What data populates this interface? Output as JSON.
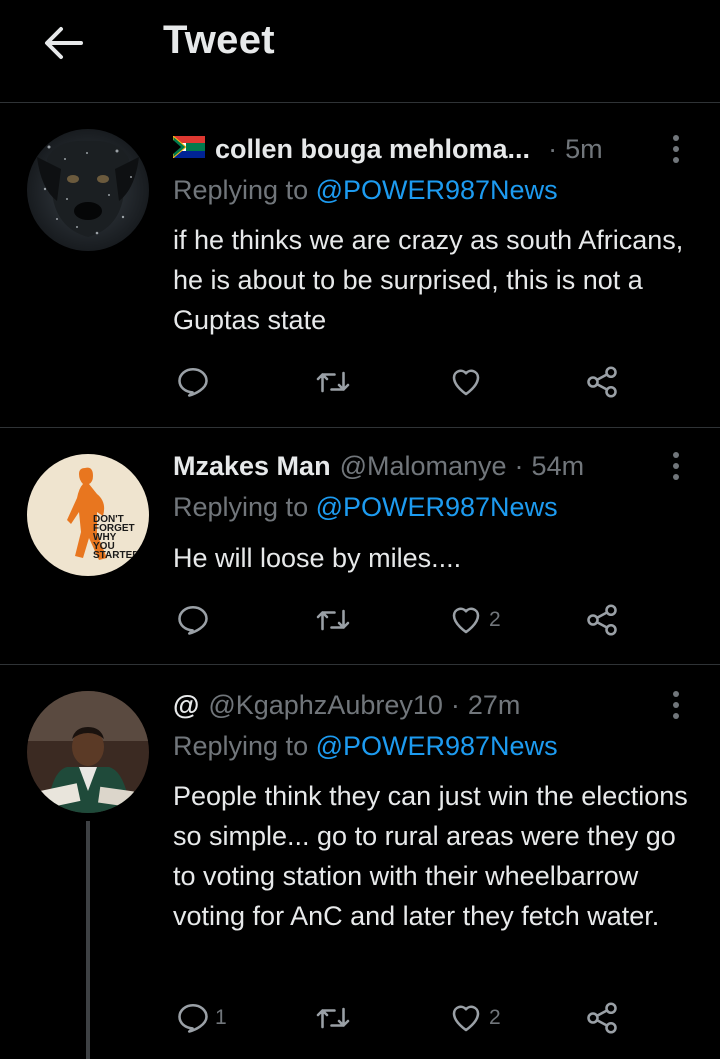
{
  "header": {
    "title": "Tweet",
    "back_icon": "arrow-left-icon"
  },
  "colors": {
    "background": "#000000",
    "link": "#1d9bf0",
    "muted": "#71767b",
    "text": "#e7e9ea",
    "divider": "#2f3336"
  },
  "tweets": [
    {
      "name": "collen bouga mehloma...",
      "handle": "",
      "time": "5m",
      "has_flag": true,
      "replying_prefix": "Replying to ",
      "replying_to": "@POWER987News",
      "text": "if he thinks we are crazy as south Africans, he is about to be surprised, this is not a Guptas state",
      "reply_count": "",
      "retweet_count": "",
      "like_count": ""
    },
    {
      "name": "Mzakes Man",
      "handle": "@Malomanye",
      "time": "54m",
      "avatar_text": [
        "DON'T",
        "FORGET",
        "WHY",
        "YOU",
        "STARTED"
      ],
      "replying_prefix": "Replying to ",
      "replying_to": "@POWER987News",
      "text": "He will loose by miles....",
      "reply_count": "",
      "retweet_count": "",
      "like_count": "2"
    },
    {
      "name": "@",
      "handle": "@KgaphzAubrey10",
      "time": "27m",
      "replying_prefix": "Replying to ",
      "replying_to": "@POWER987News",
      "text": "People think they can just win the elections so simple... go to rural areas were they go to voting station with their wheelbarrow voting for AnC and later they fetch water.",
      "reply_count": "1",
      "retweet_count": "",
      "like_count": "2"
    }
  ],
  "actions": {
    "reply_icon": "reply-icon",
    "retweet_icon": "retweet-icon",
    "like_icon": "heart-icon",
    "share_icon": "share-icon",
    "more_icon": "more-vertical-icon"
  }
}
